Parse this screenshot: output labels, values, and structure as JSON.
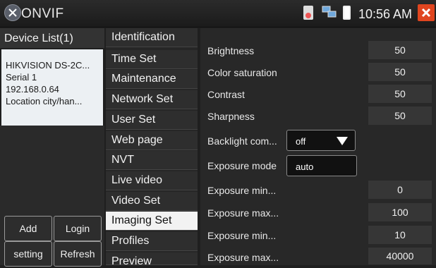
{
  "app": {
    "title": "ONVIF",
    "time": "10:56 AM"
  },
  "device_list": {
    "header": "Device List(1)",
    "device": {
      "name": "HIKVISION DS-2C...",
      "serial": "Serial  1",
      "ip": "192.168.0.64",
      "location": "Location  city/han..."
    },
    "buttons": {
      "add": "Add",
      "login": "Login",
      "setting": "setting",
      "refresh": "Refresh"
    }
  },
  "menu": {
    "items": [
      "Identification",
      "Time Set",
      "Maintenance",
      "Network Set",
      "User Set",
      "Web page",
      "NVT",
      "Live video",
      "Video Set",
      "Imaging Set",
      "Profiles",
      "Preview"
    ],
    "active": "Imaging Set"
  },
  "imaging": {
    "brightness": {
      "label": "Brightness",
      "value": "50"
    },
    "color_saturation": {
      "label": "Color saturation",
      "value": "50"
    },
    "contrast": {
      "label": "Contrast",
      "value": "50"
    },
    "sharpness": {
      "label": "Sharpness",
      "value": "50"
    },
    "backlight": {
      "label": "Backlight com...",
      "value": "off"
    },
    "exposure_mode": {
      "label": "Exposure mode",
      "value": "auto"
    },
    "exposure_min_1": {
      "label": "Exposure min...",
      "value": "0"
    },
    "exposure_max_1": {
      "label": "Exposure max...",
      "value": "100"
    },
    "exposure_min_2": {
      "label": "Exposure min...",
      "value": "10"
    },
    "exposure_max_2": {
      "label": "Exposure max...",
      "value": "40000"
    }
  },
  "colors": {
    "close": "#e0451f",
    "active_menu": "#f2f2f2",
    "card": "#ecf0f3"
  },
  "icons": [
    "onvif-logo-icon",
    "sd-card-icon",
    "network-icon",
    "battery-icon",
    "close-icon",
    "dropdown-arrow-icon"
  ]
}
